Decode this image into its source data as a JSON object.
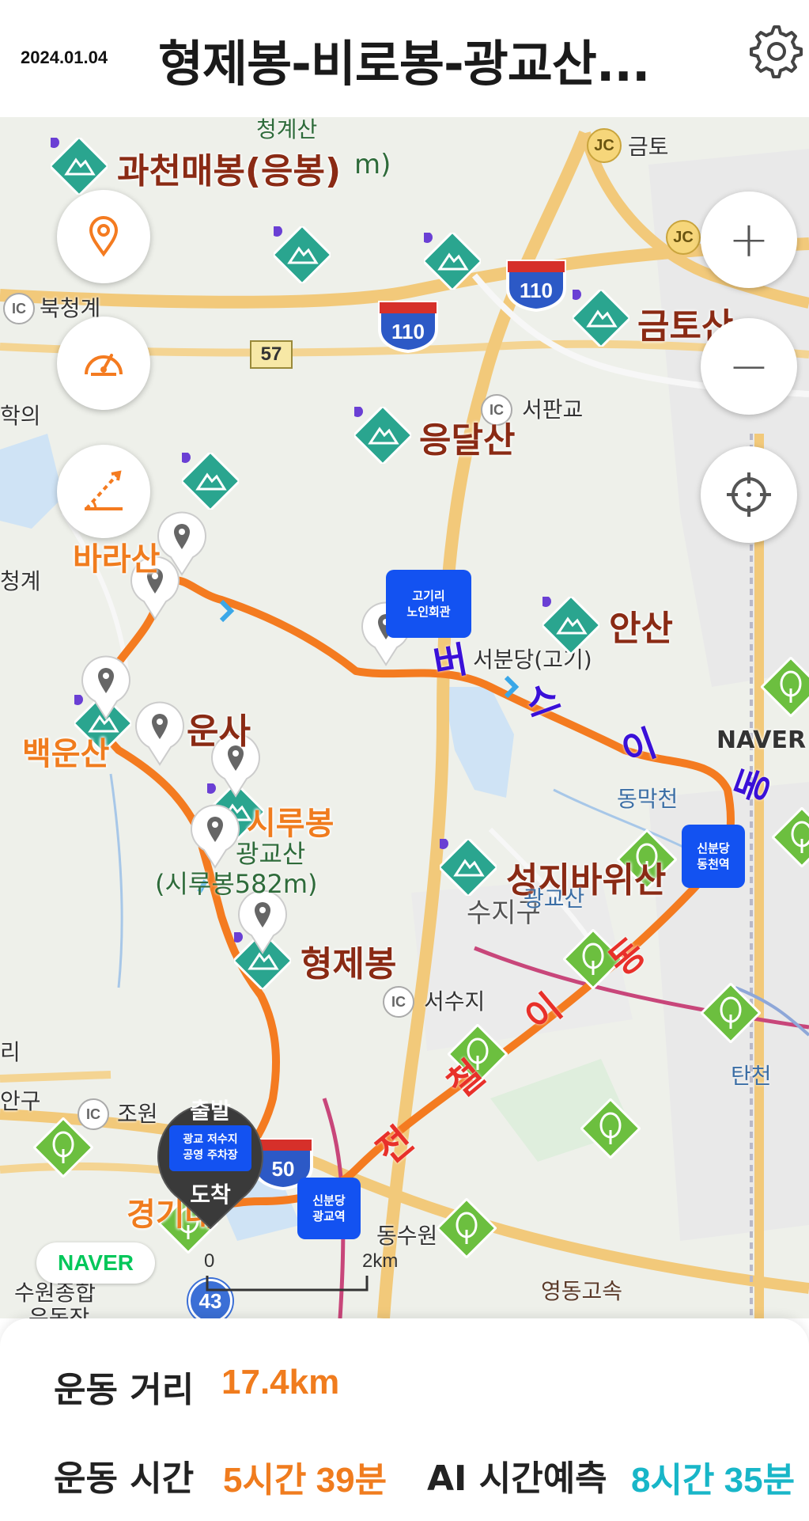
{
  "header": {
    "date": "2024.01.04",
    "title": "형제봉-비로봉-광교산..."
  },
  "map": {
    "peaks": {
      "gwacheon": "과천매봉(응봉)",
      "gwacheon_prefix": "청계산",
      "gwacheon_suffix": "m)",
      "eungdal": "응달산",
      "ansan": "안산",
      "seongji": "성지바위산",
      "baekunsan": "백운산",
      "unsa": "운사",
      "siru": "시루봉",
      "hyeongje": "형제봉",
      "seongji_sub": "광교산",
      "sirubong_height": "(시루봉582m)",
      "sirubong_sub": "광교산",
      "barasan": "바라산",
      "baekun": "백운산",
      "gyeonggidae": "경기대",
      "geumtosan": "금토산"
    },
    "places": {
      "geumto": "금토",
      "bukcheonggye": "북청계",
      "seopangyo": "서판교",
      "hakui": "학의",
      "cheonggye": "청계",
      "seobundang": "서분당(고기)",
      "dongmakcheon": "동막천",
      "suji": "수지구",
      "seosuji": "서수지",
      "tancheon": "탄천",
      "anggu": "안구",
      "jowon": "조원",
      "dongsuwon": "동수원",
      "yeongdong": "영동고속",
      "suwon": "수원종합",
      "suwon2": "운동장",
      "naver_building": "NAVER",
      "left_edge_l": "리"
    },
    "roads": {
      "hwy_110a": "110",
      "hwy_110b": "110",
      "hwy_50": "50",
      "rt_57": "57",
      "rt_43": "43"
    },
    "badges": {
      "ic": "IC",
      "jc": "JC"
    },
    "stations": {
      "gogiri": "고기리\n노인회관",
      "dongcheon": "신분당\n동천역",
      "gwanggyo": "신분당\n광교역"
    },
    "route_labels": {
      "bus": [
        "버",
        "스",
        "이",
        "동"
      ],
      "subway": [
        "전",
        "철",
        "이",
        "동"
      ]
    },
    "start_marker": {
      "top": "출발",
      "middle": "광교 저수지\n공영 주차장",
      "bottom": "도착"
    },
    "naver_logo": "NAVER",
    "scale": {
      "zero": "0",
      "distance": "2km"
    },
    "buttons": {
      "zoom_in": "+",
      "zoom_out": "−"
    }
  },
  "stats": {
    "distance_label": "운동 거리",
    "distance_value": "17.4km",
    "time_label": "운동 시간",
    "time_value": "5시간 39분",
    "ai_label": "AI 시간예측",
    "ai_value": "8시간 35분"
  },
  "colors": {
    "route": "#f47b20",
    "peak_green": "#2aa58f",
    "tree_green": "#6cbf3f",
    "station_blue": "#1352f1",
    "ai_cyan": "#18b6c8",
    "orange_value": "#f07c1e"
  },
  "icons": [
    "gear-icon",
    "location-pin-icon",
    "speedometer-icon",
    "slope-icon",
    "plus-icon",
    "minus-icon",
    "crosshair-icon"
  ]
}
